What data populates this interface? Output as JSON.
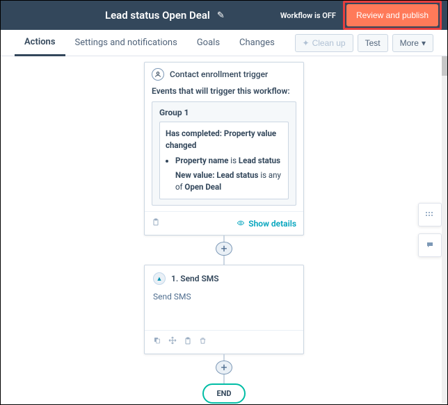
{
  "header": {
    "title": "Lead status Open Deal",
    "status": "Workflow is OFF",
    "review_label": "Review and publish"
  },
  "tabs": {
    "items": [
      {
        "label": "Actions",
        "active": true
      },
      {
        "label": "Settings and notifications",
        "active": false
      },
      {
        "label": "Goals",
        "active": false
      },
      {
        "label": "Changes",
        "active": false
      }
    ],
    "tools": {
      "cleanup": "Clean up",
      "test": "Test",
      "more": "More"
    }
  },
  "trigger": {
    "title": "Contact enrollment trigger",
    "subtitle": "Events that will trigger this workflow:",
    "group_label": "Group 1",
    "filter_title": "Has completed: Property value changed",
    "prop_label": "Property name",
    "prop_is": "is",
    "prop_value": "Lead status",
    "newval_label": "New value:",
    "newval_prop": "Lead status",
    "newval_is": "is any of",
    "newval_value": "Open Deal",
    "show_details": "Show details"
  },
  "action": {
    "step_label": "1. Send SMS",
    "body": "Send SMS"
  },
  "end_label": "END"
}
